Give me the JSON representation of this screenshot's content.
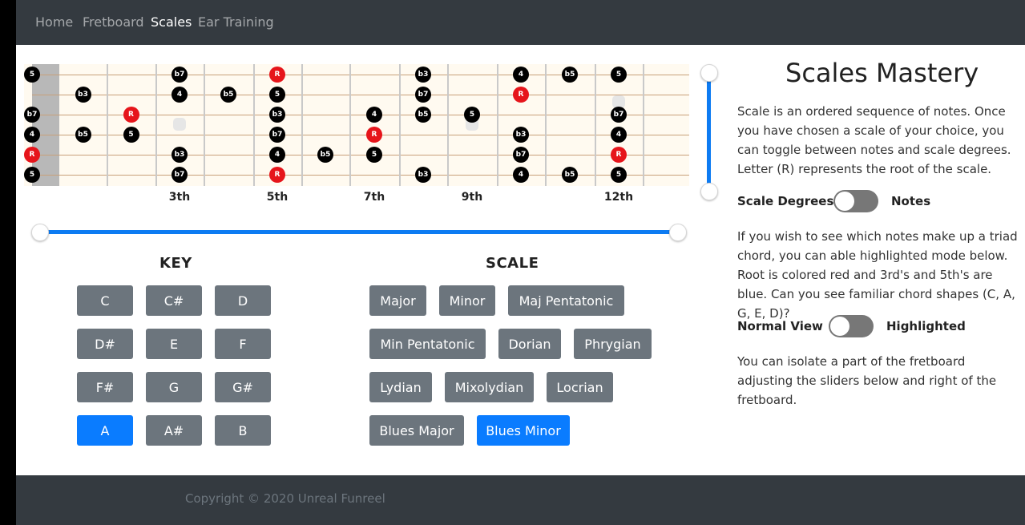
{
  "nav": {
    "items": [
      {
        "label": "Home",
        "active": false
      },
      {
        "label": "Fretboard",
        "active": false
      },
      {
        "label": "Scales",
        "active": true
      },
      {
        "label": "Ear Training",
        "active": false
      }
    ]
  },
  "fretboard": {
    "fret_labels": [
      "3th",
      "5th",
      "7th",
      "9th",
      "12th"
    ],
    "notes": [
      {
        "string": 1,
        "fret": 0,
        "label": "5"
      },
      {
        "string": 1,
        "fret": 3,
        "label": "b7"
      },
      {
        "string": 1,
        "fret": 5,
        "label": "R"
      },
      {
        "string": 1,
        "fret": 8,
        "label": "b3"
      },
      {
        "string": 1,
        "fret": 10,
        "label": "4"
      },
      {
        "string": 1,
        "fret": 11,
        "label": "b5"
      },
      {
        "string": 1,
        "fret": 12,
        "label": "5"
      },
      {
        "string": 2,
        "fret": 1,
        "label": "b3"
      },
      {
        "string": 2,
        "fret": 3,
        "label": "4"
      },
      {
        "string": 2,
        "fret": 4,
        "label": "b5"
      },
      {
        "string": 2,
        "fret": 5,
        "label": "5"
      },
      {
        "string": 2,
        "fret": 8,
        "label": "b7"
      },
      {
        "string": 2,
        "fret": 10,
        "label": "R"
      },
      {
        "string": 3,
        "fret": 0,
        "label": "b7"
      },
      {
        "string": 3,
        "fret": 2,
        "label": "R"
      },
      {
        "string": 3,
        "fret": 5,
        "label": "b3"
      },
      {
        "string": 3,
        "fret": 7,
        "label": "4"
      },
      {
        "string": 3,
        "fret": 8,
        "label": "b5"
      },
      {
        "string": 3,
        "fret": 9,
        "label": "5"
      },
      {
        "string": 3,
        "fret": 12,
        "label": "b7"
      },
      {
        "string": 4,
        "fret": 0,
        "label": "4"
      },
      {
        "string": 4,
        "fret": 1,
        "label": "b5"
      },
      {
        "string": 4,
        "fret": 2,
        "label": "5"
      },
      {
        "string": 4,
        "fret": 5,
        "label": "b7"
      },
      {
        "string": 4,
        "fret": 7,
        "label": "R"
      },
      {
        "string": 4,
        "fret": 10,
        "label": "b3"
      },
      {
        "string": 4,
        "fret": 12,
        "label": "4"
      },
      {
        "string": 5,
        "fret": 0,
        "label": "R"
      },
      {
        "string": 5,
        "fret": 3,
        "label": "b3"
      },
      {
        "string": 5,
        "fret": 5,
        "label": "4"
      },
      {
        "string": 5,
        "fret": 6,
        "label": "b5"
      },
      {
        "string": 5,
        "fret": 7,
        "label": "5"
      },
      {
        "string": 5,
        "fret": 10,
        "label": "b7"
      },
      {
        "string": 5,
        "fret": 12,
        "label": "R"
      },
      {
        "string": 6,
        "fret": 0,
        "label": "5"
      },
      {
        "string": 6,
        "fret": 3,
        "label": "b7"
      },
      {
        "string": 6,
        "fret": 5,
        "label": "R"
      },
      {
        "string": 6,
        "fret": 8,
        "label": "b3"
      },
      {
        "string": 6,
        "fret": 10,
        "label": "4"
      },
      {
        "string": 6,
        "fret": 11,
        "label": "b5"
      },
      {
        "string": 6,
        "fret": 12,
        "label": "5"
      }
    ]
  },
  "key": {
    "title": "KEY",
    "buttons": [
      {
        "label": "C",
        "active": false
      },
      {
        "label": "C#",
        "active": false
      },
      {
        "label": "D",
        "active": false
      },
      {
        "label": "D#",
        "active": false
      },
      {
        "label": "E",
        "active": false
      },
      {
        "label": "F",
        "active": false
      },
      {
        "label": "F#",
        "active": false
      },
      {
        "label": "G",
        "active": false
      },
      {
        "label": "G#",
        "active": false
      },
      {
        "label": "A",
        "active": true
      },
      {
        "label": "A#",
        "active": false
      },
      {
        "label": "B",
        "active": false
      }
    ]
  },
  "scale": {
    "title": "SCALE",
    "buttons": [
      {
        "label": "Major",
        "active": false
      },
      {
        "label": "Minor",
        "active": false
      },
      {
        "label": "Maj Pentatonic",
        "active": false
      },
      {
        "label": "Min Pentatonic",
        "active": false
      },
      {
        "label": "Dorian",
        "active": false
      },
      {
        "label": "Phrygian",
        "active": false
      },
      {
        "label": "Lydian",
        "active": false
      },
      {
        "label": "Mixolydian",
        "active": false
      },
      {
        "label": "Locrian",
        "active": false
      },
      {
        "label": "Blues Major",
        "active": false
      },
      {
        "label": "Blues Minor",
        "active": true
      }
    ]
  },
  "panel": {
    "title": "Scales Mastery",
    "intro": "Scale is an ordered sequence of notes. Once you have chosen a scale of your choice, you can toggle between notes and scale degrees. Letter (R) represents the root of the scale.",
    "toggle1_left": "Scale Degrees",
    "toggle1_right": "Notes",
    "triad_text": "If you wish to see which notes make up a triad chord, you can able highlighted mode below. Root is colored red and 3rd's and 5th's are blue. Can you see familiar chord shapes (C, A, G, E, D)?",
    "toggle2_left": "Normal View",
    "toggle2_right": "Highlighted",
    "slider_text": "You can isolate a part of the fretboard adjusting the sliders below and right of the fretboard."
  },
  "footer": {
    "copyright": "Copyright © 2020 Unreal Funreel"
  }
}
